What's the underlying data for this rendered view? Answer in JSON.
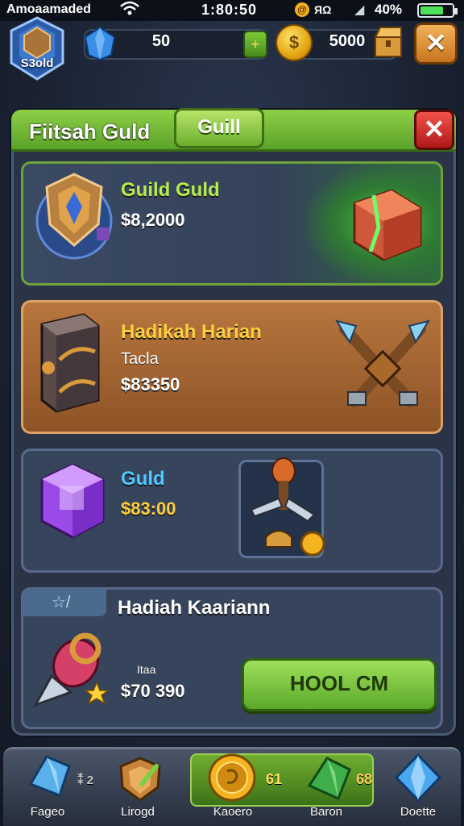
{
  "status_bar": {
    "carrier": "Amoaamaded",
    "time": "1:80:50",
    "alarm_glyph": "@",
    "misc": "ЯΩ",
    "battery_pct": "40%"
  },
  "resources": {
    "player_label": "S3old",
    "gems": "50",
    "gem_add": "+",
    "coins": "5000",
    "coin_glyph": "$",
    "close_glyph": "✕"
  },
  "panel": {
    "title": "Fiitsah Guld",
    "tab_label": "Guill",
    "close_glyph": "✕"
  },
  "items": [
    {
      "name": "Guild Guld",
      "price": "$8,2000"
    },
    {
      "name": "Hadikah Harian",
      "subtitle": "Tacla",
      "price": "$83350"
    },
    {
      "name": "Guld",
      "price": "$83:00"
    },
    {
      "name": "Hadiah Kaariann",
      "subtitle": "Itaa",
      "price": "$70 390",
      "tab_glyph": "☆/"
    }
  ],
  "buy_button": {
    "label": "HOOL CM"
  },
  "bottom_nav": {
    "items": [
      {
        "label": "Fageo",
        "badge": "⁑ 2"
      },
      {
        "label": "Lirogd",
        "badge": ""
      },
      {
        "label": "Kaoero",
        "badge": "61"
      },
      {
        "label": "Baron",
        "badge": "68"
      },
      {
        "label": "Doette",
        "badge": ""
      }
    ]
  },
  "colors": {
    "accent_green": "#6fb234",
    "gold": "#f3b420",
    "danger_red": "#d42a22"
  }
}
